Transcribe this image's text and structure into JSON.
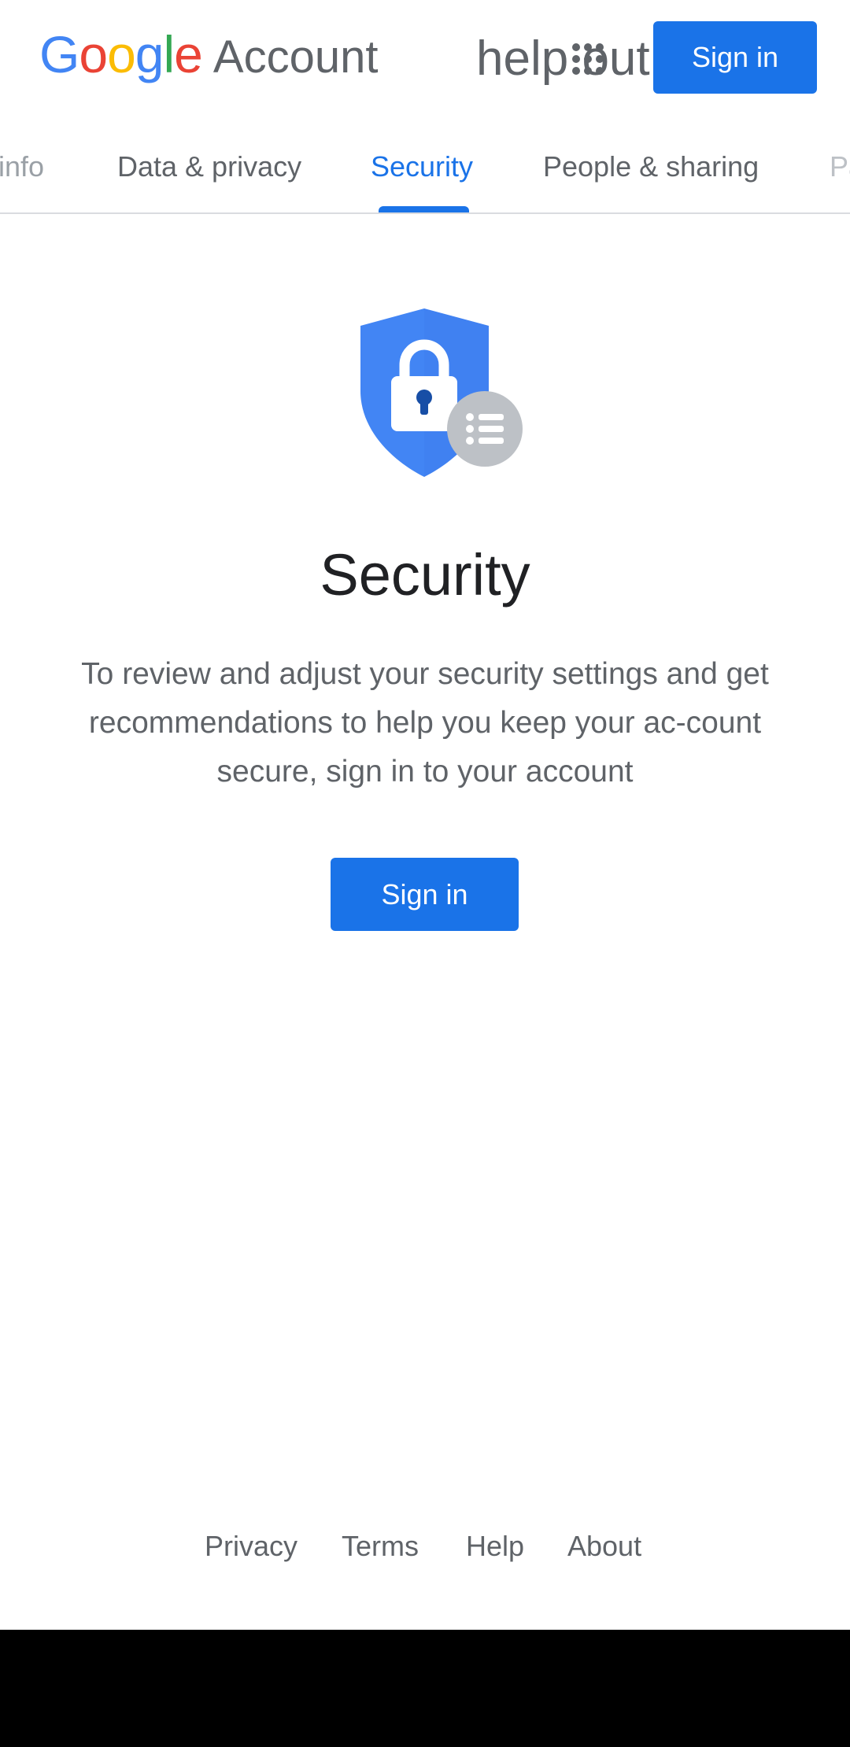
{
  "header": {
    "logo_letters": [
      {
        "char": "G",
        "color": "#4285F4"
      },
      {
        "char": "o",
        "color": "#EA4335"
      },
      {
        "char": "o",
        "color": "#FBBC05"
      },
      {
        "char": "g",
        "color": "#4285F4"
      },
      {
        "char": "l",
        "color": "#34A853"
      },
      {
        "char": "e",
        "color": "#EA4335"
      }
    ],
    "logo_suffix": "Account",
    "help_text": "help out",
    "apps_icon": "apps-grid-icon",
    "signin_label": "Sign in"
  },
  "tabs": [
    {
      "label": "info",
      "state": "partial"
    },
    {
      "label": "Data & privacy",
      "state": "normal"
    },
    {
      "label": "Security",
      "state": "active"
    },
    {
      "label": "People & sharing",
      "state": "normal"
    },
    {
      "label": "Pa",
      "state": "partial"
    }
  ],
  "main": {
    "illustration": "shield-lock-icon",
    "title": "Security",
    "description": "To review and adjust your security settings and get recommendations to help you keep your ac-count secure, sign in to your account",
    "signin_label": "Sign in"
  },
  "footer": {
    "links": [
      "Privacy",
      "Terms",
      "Help",
      "About"
    ]
  },
  "colors": {
    "accent": "#1a73e8",
    "shield": "#4285F4",
    "text_secondary": "#5f6368"
  }
}
